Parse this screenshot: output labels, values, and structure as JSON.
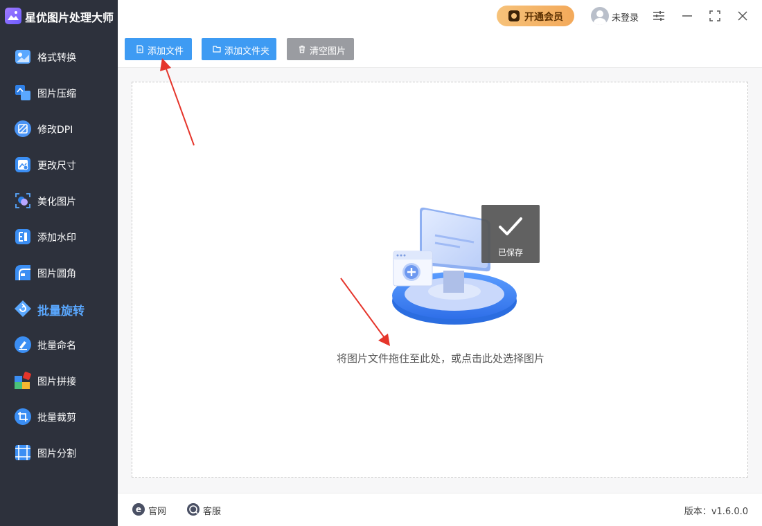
{
  "app": {
    "title": "星优图片处理大师"
  },
  "sidebar": {
    "items": [
      {
        "label": "格式转换",
        "icon": "format-convert-icon",
        "active": false
      },
      {
        "label": "图片压缩",
        "icon": "image-compress-icon",
        "active": false
      },
      {
        "label": "修改DPI",
        "icon": "dpi-icon",
        "active": false
      },
      {
        "label": "更改尺寸",
        "icon": "resize-icon",
        "active": false
      },
      {
        "label": "美化图片",
        "icon": "beautify-icon",
        "active": false
      },
      {
        "label": "添加水印",
        "icon": "watermark-icon",
        "active": false
      },
      {
        "label": "图片圆角",
        "icon": "round-corner-icon",
        "active": false
      },
      {
        "label": "批量旋转",
        "icon": "rotate-icon",
        "active": true
      },
      {
        "label": "批量命名",
        "icon": "rename-icon",
        "active": false
      },
      {
        "label": "图片拼接",
        "icon": "stitch-icon",
        "active": false
      },
      {
        "label": "批量裁剪",
        "icon": "crop-icon",
        "active": false
      },
      {
        "label": "图片分割",
        "icon": "split-icon",
        "active": false
      }
    ]
  },
  "header": {
    "vip_label": "开通会员",
    "user_label": "未登录"
  },
  "toolbar": {
    "add_file": "添加文件",
    "add_folder": "添加文件夹",
    "clear": "清空图片"
  },
  "main": {
    "drop_hint": "将图片文件拖住至此处，或点击此处选择图片"
  },
  "toast": {
    "label": "已保存"
  },
  "footer": {
    "website": "官网",
    "support": "客服",
    "version_label": "版本：",
    "version_value": "v1.6.0.0"
  },
  "colors": {
    "sidebar_bg": "#2d313c",
    "accent": "#3e9bf3",
    "active_text": "#5aa8ff",
    "annotation_arrow": "#e5352b"
  }
}
